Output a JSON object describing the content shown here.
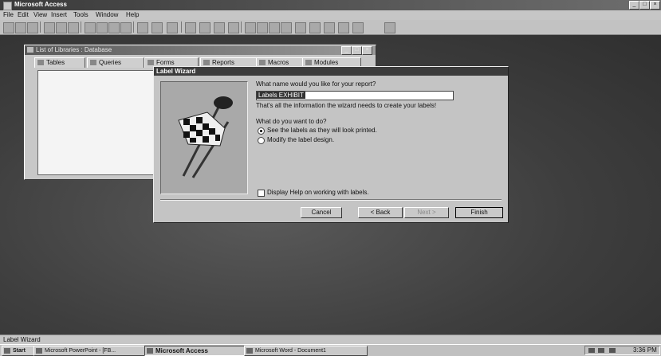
{
  "app": {
    "title": "Microsoft Access"
  },
  "menu": {
    "items": [
      "File",
      "Edit",
      "View",
      "Insert",
      "Tools",
      "Window",
      "Help"
    ]
  },
  "db_window": {
    "title": "List of Libraries : Database",
    "tabs": [
      "Tables",
      "Queries",
      "Forms",
      "Reports",
      "Macros",
      "Modules"
    ]
  },
  "wizard": {
    "title": "Label Wizard",
    "question": "What name would you like for your report?",
    "name_value": "Labels EXHIBIT",
    "info": "That's all the information the wizard needs to create your labels!",
    "prompt": "What do you want to do?",
    "options": [
      "See the labels as they will look printed.",
      "Modify the label design."
    ],
    "selected_option": 0,
    "help_label": "Display Help on working with labels.",
    "buttons": {
      "cancel": "Cancel",
      "back": "< Back",
      "next": "Next >",
      "finish": "Finish"
    }
  },
  "status": {
    "text": "Label Wizard"
  },
  "taskbar": {
    "start": "Start",
    "tasks": [
      "Microsoft PowerPoint - [FB...",
      "Microsoft Access",
      "Microsoft Word - Document1"
    ],
    "active_task": 1,
    "clock": "3:36 PM"
  }
}
